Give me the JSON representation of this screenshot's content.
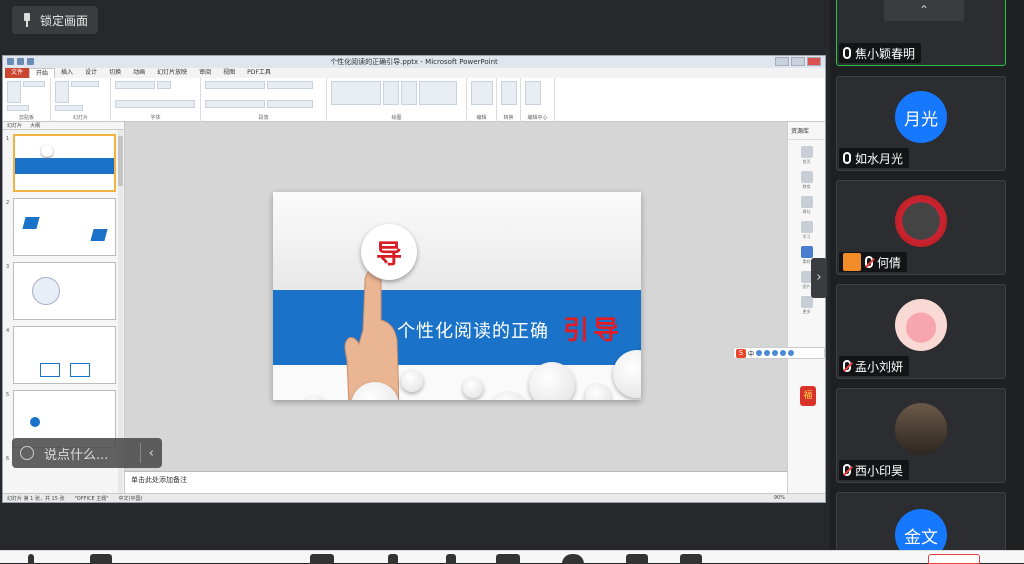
{
  "toolbar": {
    "lock_label": "锁定画面"
  },
  "ppt": {
    "window_title": "个性化阅读的正确引导.pptx - Microsoft PowerPoint",
    "tabs": [
      "文件",
      "开始",
      "插入",
      "设计",
      "切换",
      "动画",
      "幻灯片放映",
      "审阅",
      "视图",
      "PDF工具"
    ],
    "groups": [
      "剪贴板",
      "幻灯片",
      "字体",
      "段落",
      "绘图",
      "编辑",
      "转换",
      "编辑中心"
    ],
    "thumb_tabs": [
      "幻灯片",
      "大纲"
    ],
    "thumb_numbers": [
      "1",
      "2",
      "3",
      "4",
      "5",
      "6"
    ],
    "notes_placeholder": "单击此处添加备注",
    "status": {
      "slide": "幻灯片 第 1 张，共 15 张",
      "theme": "\"OFFICE 主题\"",
      "lang": "中文(中国)",
      "zoom": "90%"
    },
    "side_pane": {
      "header": "资源库",
      "items": [
        "首页",
        "教育",
        "建站",
        "学习",
        "素材",
        "图片",
        "更多"
      ]
    }
  },
  "slide": {
    "badge": "导",
    "title": "个性化阅读的正确",
    "highlight": "引导"
  },
  "chat": {
    "placeholder": "说点什么..."
  },
  "participants": [
    {
      "name": "焦小颖春明",
      "muted": false,
      "avatar_text": "",
      "active": true
    },
    {
      "name": "如水月光",
      "muted": false,
      "avatar_text": "月光",
      "avatar_color": "#1677ff"
    },
    {
      "name": "何倩",
      "muted": true,
      "avatar_text": ""
    },
    {
      "name": "孟小刘妍",
      "muted": true,
      "avatar_text": ""
    },
    {
      "name": "西小印昊",
      "muted": true,
      "avatar_text": ""
    },
    {
      "name": "",
      "muted": false,
      "avatar_text": "金文",
      "avatar_color": "#1677ff"
    }
  ],
  "ime_label": "中",
  "fu_label": "福",
  "colors": {
    "accent": "#27c24c",
    "band": "#1a73c9",
    "highlight": "#e31b23"
  }
}
